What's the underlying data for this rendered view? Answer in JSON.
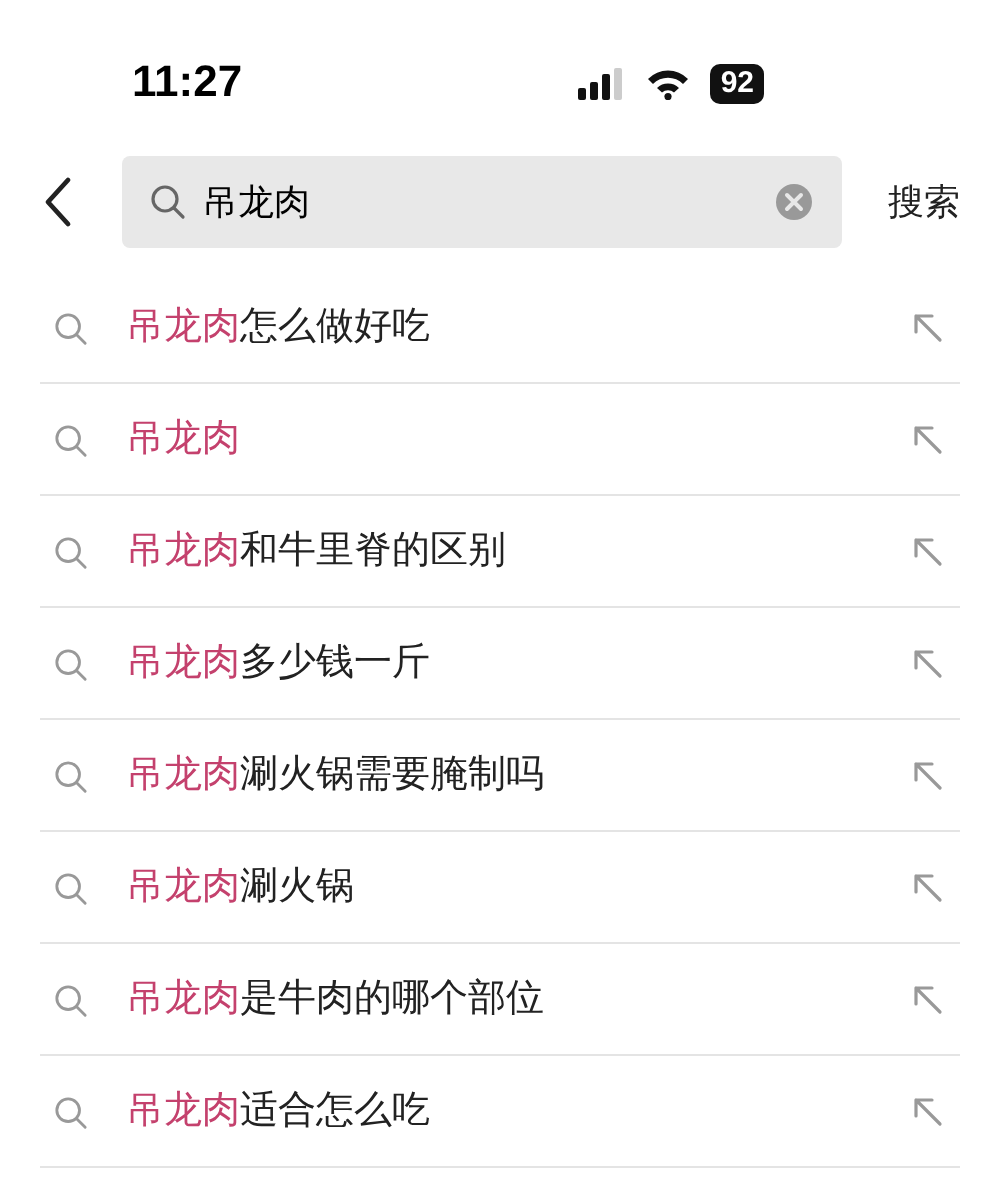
{
  "status_bar": {
    "time": "11:27",
    "battery": "92"
  },
  "search": {
    "value": "吊龙肉",
    "action": "搜索"
  },
  "suggestions": [
    {
      "match": "吊龙肉",
      "rest": "怎么做好吃"
    },
    {
      "match": "吊龙肉"
    },
    {
      "match": "吊龙肉",
      "rest": "和牛里脊的区别"
    },
    {
      "match": "吊龙肉",
      "rest": "多少钱一斤"
    },
    {
      "match": "吊龙肉",
      "rest": "涮火锅需要腌制吗"
    },
    {
      "match": "吊龙肉",
      "rest": "涮火锅"
    },
    {
      "match": "吊龙肉",
      "rest": "是牛肉的哪个部位"
    },
    {
      "match": "吊龙肉",
      "rest": "适合怎么吃"
    }
  ]
}
